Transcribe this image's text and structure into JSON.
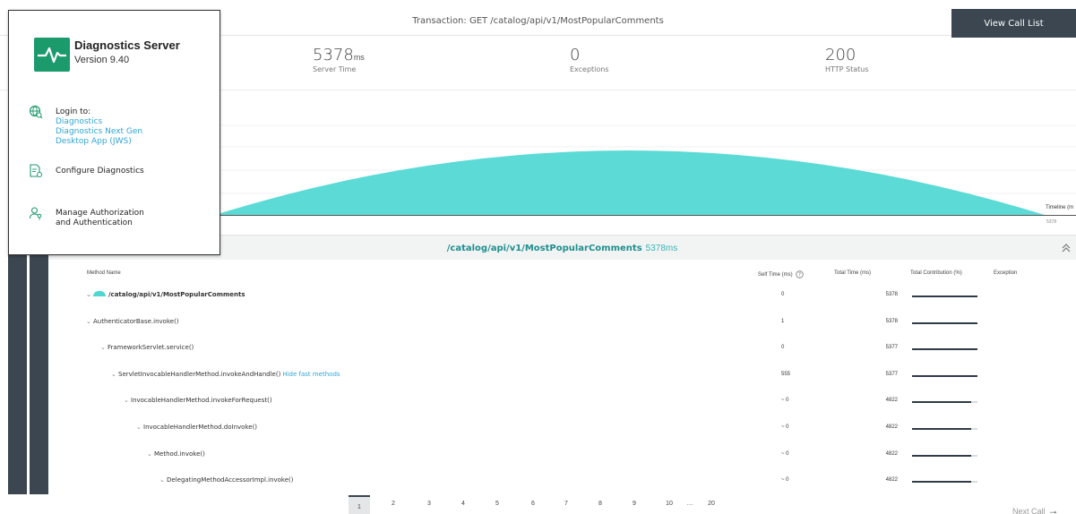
{
  "header": {
    "transaction_title": "Transaction: GET /catalog/api/v1/MostPopularComments",
    "view_call_list": "View Call List"
  },
  "metrics": [
    {
      "value": "5378",
      "unit": "ms",
      "label": "Server Time"
    },
    {
      "value": "0",
      "unit": "",
      "label": "Exceptions"
    },
    {
      "value": "200",
      "unit": "",
      "label": "HTTP Status"
    }
  ],
  "timeline": {
    "label": "Timeline (m",
    "end_tick": "5378",
    "fill_color": "#5cdbd6"
  },
  "call_tree": {
    "title_path": "/catalog/api/v1/MostPopularComments",
    "title_time": "5378ms",
    "columns": {
      "method_name": "Method Name",
      "self_time": "Self Time (ms)",
      "total_time": "Total Time (ms)",
      "total_contribution": "Total Contribution (%)",
      "exception": "Exception"
    },
    "rows": [
      {
        "name": "/catalog/api/v1/MostPopularComments",
        "self": "0",
        "total": "5378",
        "contribution": 1.0
      },
      {
        "name": "AuthenticatorBase.invoke()",
        "self": "1",
        "total": "5378",
        "contribution": 1.0
      },
      {
        "name": "FrameworkServlet.service()",
        "self": "0",
        "total": "5377",
        "contribution": 1.0
      },
      {
        "name": "ServletInvocableHandlerMethod.invokeAndHandle()",
        "self": "555",
        "total": "5377",
        "contribution": 1.0,
        "link": "Hide fast methods"
      },
      {
        "name": "InvocableHandlerMethod.invokeForRequest()",
        "self": "~ 0",
        "total": "4822",
        "contribution": 0.9
      },
      {
        "name": "InvocableHandlerMethod.doInvoke()",
        "self": "~ 0",
        "total": "4822",
        "contribution": 0.9
      },
      {
        "name": "Method.invoke()",
        "self": "~ 0",
        "total": "4822",
        "contribution": 0.9
      },
      {
        "name": "DelegatingMethodAccessorImpl.invoke()",
        "self": "~ 0",
        "total": "4822",
        "contribution": 0.9
      }
    ]
  },
  "pagination": {
    "pages": [
      "1",
      "2",
      "3",
      "4",
      "5",
      "6",
      "7",
      "8",
      "9",
      "10",
      "…",
      "20"
    ],
    "active": "1",
    "next_call": "Next Call"
  },
  "popup": {
    "product_name": "Diagnostics Server",
    "version": "Version 9.40",
    "login_label": "Login to:",
    "login_links": [
      "Diagnostics",
      "Diagnostics Next Gen",
      "Desktop App (JWS)"
    ],
    "configure": "Configure Diagnostics",
    "manage_line1": "Manage Authorization",
    "manage_line2": "and Authentication"
  },
  "colors": {
    "accent_teal": "#5cdbd6",
    "dark_slate": "#3b4650",
    "link_blue": "#2fa6d6",
    "logo_green": "#1b9a6c"
  }
}
